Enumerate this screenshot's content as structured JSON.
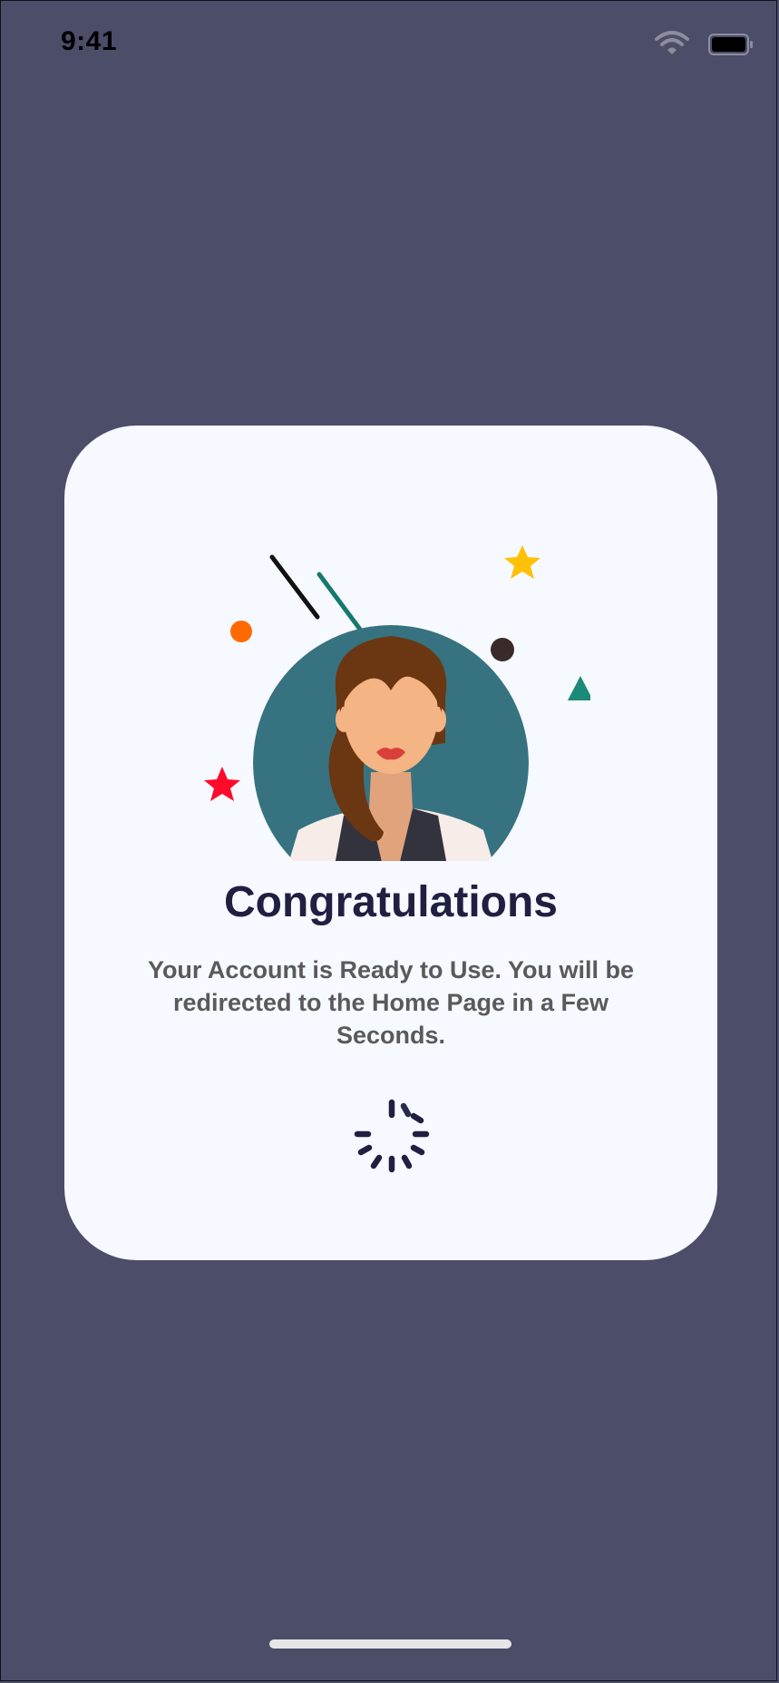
{
  "status_bar": {
    "time": "9:41"
  },
  "dialog": {
    "title": "Congratulations",
    "message": "Your Account is Ready to Use. You will be redirected to the Home Page in a Few Seconds."
  },
  "colors": {
    "background": "#4b4d69",
    "card": "#f6f9ff",
    "title": "#1f2041",
    "message": "#5a5a5a",
    "avatar_circle": "#377280"
  },
  "icons": {
    "wifi": "wifi-icon",
    "battery": "battery-icon",
    "spinner": "loading-spinner-icon"
  }
}
